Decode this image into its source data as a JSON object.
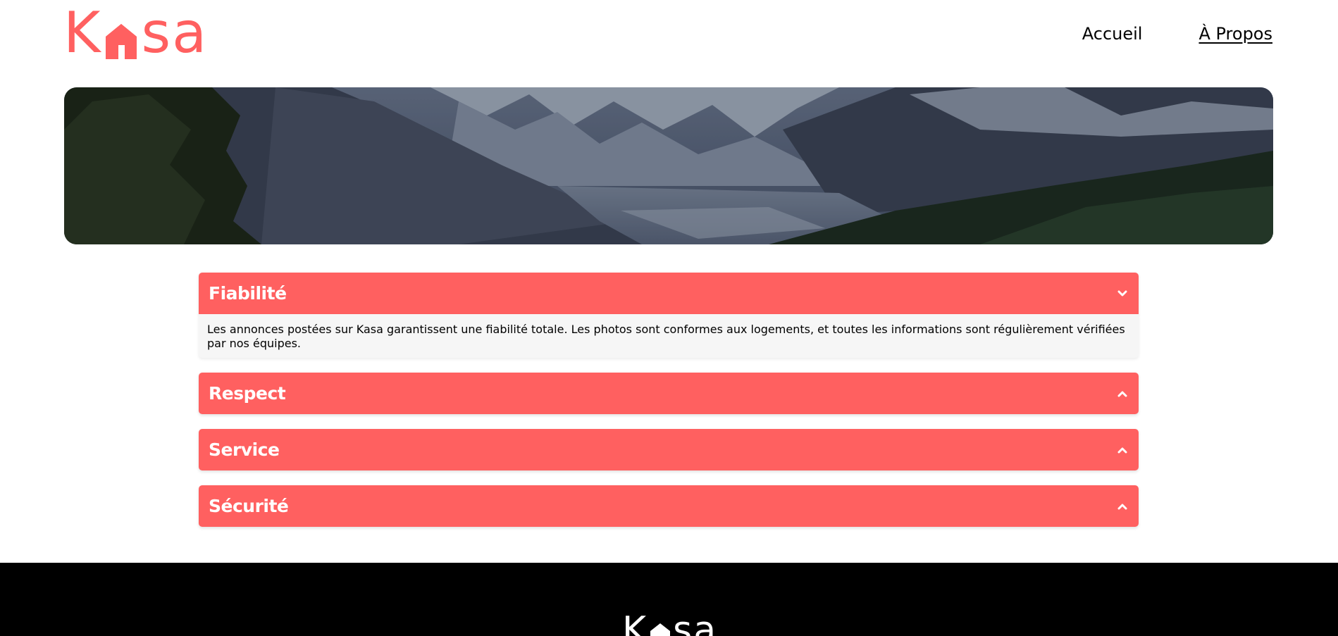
{
  "brand": {
    "letters_before": "K",
    "letters_after": "sa",
    "color": "#FF6060"
  },
  "nav": {
    "home": "Accueil",
    "about": "À Propos"
  },
  "collapses": [
    {
      "title": "Fiabilité",
      "open": true,
      "icon": "chevron-down-icon",
      "content": "Les annonces postées sur Kasa garantissent une fiabilité totale. Les photos sont conformes aux logements, et toutes les informations sont régulièrement vérifiées par nos équipes."
    },
    {
      "title": "Respect",
      "open": false,
      "icon": "chevron-up-icon"
    },
    {
      "title": "Service",
      "open": false,
      "icon": "chevron-up-icon"
    },
    {
      "title": "Sécurité",
      "open": false,
      "icon": "chevron-up-icon"
    }
  ],
  "colors": {
    "accent": "#FF6060",
    "panel": "#F6F6F6",
    "footer": "#000000"
  }
}
